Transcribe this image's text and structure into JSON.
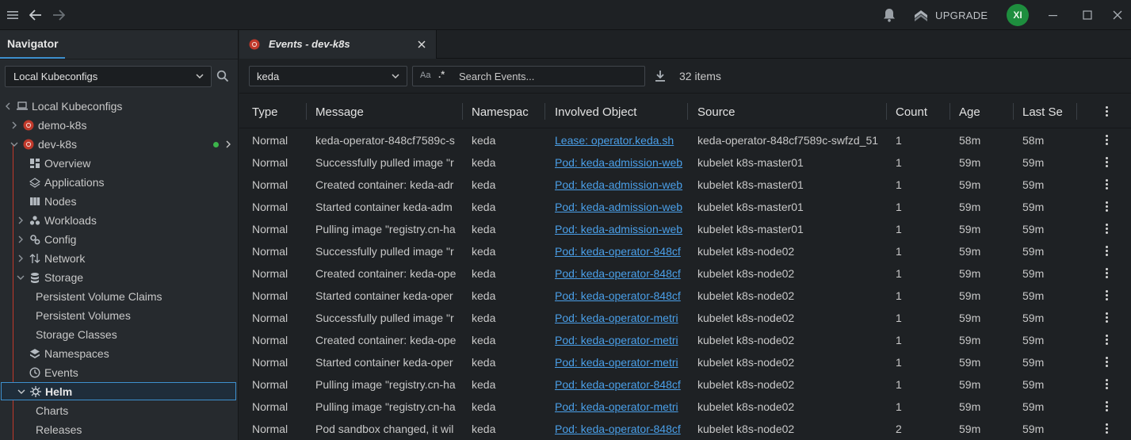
{
  "topbar": {
    "upgrade_label": "UPGRADE",
    "avatar_initials": "XI",
    "avatar_color": "#1e8e3e"
  },
  "navigator": {
    "tab_label": "Navigator",
    "kubeconfig_select": "Local Kubeconfigs",
    "tree": {
      "root": "Local Kubeconfigs",
      "clusters": [
        "demo-k8s",
        "dev-k8s"
      ],
      "items": {
        "overview": "Overview",
        "applications": "Applications",
        "nodes": "Nodes",
        "workloads": "Workloads",
        "config": "Config",
        "network": "Network",
        "storage": "Storage",
        "pvc": "Persistent Volume Claims",
        "pv": "Persistent Volumes",
        "storage_classes": "Storage Classes",
        "namespaces": "Namespaces",
        "events": "Events",
        "helm": "Helm",
        "charts": "Charts",
        "releases": "Releases"
      }
    }
  },
  "main": {
    "tab_title": "Events - dev-k8s",
    "namespace_filter": "keda",
    "search_toggle_case": "Aa",
    "search_toggle_regex": ".*",
    "search_placeholder": "Search Events...",
    "item_count": "32 items",
    "columns": [
      "Type",
      "Message",
      "Namespac",
      "Involved Object",
      "Source",
      "Count",
      "Age",
      "Last Se"
    ],
    "rows": [
      {
        "type": "Normal",
        "message": "keda-operator-848cf7589c-s",
        "namespace": "keda",
        "object": "Lease: operator.keda.sh",
        "source": "keda-operator-848cf7589c-swfzd_51",
        "count": "1",
        "age": "58m",
        "last": "58m"
      },
      {
        "type": "Normal",
        "message": "Successfully pulled image \"r",
        "namespace": "keda",
        "object": "Pod: keda-admission-web",
        "source": "kubelet k8s-master01",
        "count": "1",
        "age": "59m",
        "last": "59m"
      },
      {
        "type": "Normal",
        "message": "Created container: keda-adr",
        "namespace": "keda",
        "object": "Pod: keda-admission-web",
        "source": "kubelet k8s-master01",
        "count": "1",
        "age": "59m",
        "last": "59m"
      },
      {
        "type": "Normal",
        "message": "Started container keda-adm",
        "namespace": "keda",
        "object": "Pod: keda-admission-web",
        "source": "kubelet k8s-master01",
        "count": "1",
        "age": "59m",
        "last": "59m"
      },
      {
        "type": "Normal",
        "message": "Pulling image \"registry.cn-ha",
        "namespace": "keda",
        "object": "Pod: keda-admission-web",
        "source": "kubelet k8s-master01",
        "count": "1",
        "age": "59m",
        "last": "59m"
      },
      {
        "type": "Normal",
        "message": "Successfully pulled image \"r",
        "namespace": "keda",
        "object": "Pod: keda-operator-848cf",
        "source": "kubelet k8s-node02",
        "count": "1",
        "age": "59m",
        "last": "59m"
      },
      {
        "type": "Normal",
        "message": "Created container: keda-ope",
        "namespace": "keda",
        "object": "Pod: keda-operator-848cf",
        "source": "kubelet k8s-node02",
        "count": "1",
        "age": "59m",
        "last": "59m"
      },
      {
        "type": "Normal",
        "message": "Started container keda-oper",
        "namespace": "keda",
        "object": "Pod: keda-operator-848cf",
        "source": "kubelet k8s-node02",
        "count": "1",
        "age": "59m",
        "last": "59m"
      },
      {
        "type": "Normal",
        "message": "Successfully pulled image \"r",
        "namespace": "keda",
        "object": "Pod: keda-operator-metri",
        "source": "kubelet k8s-node02",
        "count": "1",
        "age": "59m",
        "last": "59m"
      },
      {
        "type": "Normal",
        "message": "Created container: keda-ope",
        "namespace": "keda",
        "object": "Pod: keda-operator-metri",
        "source": "kubelet k8s-node02",
        "count": "1",
        "age": "59m",
        "last": "59m"
      },
      {
        "type": "Normal",
        "message": "Started container keda-oper",
        "namespace": "keda",
        "object": "Pod: keda-operator-metri",
        "source": "kubelet k8s-node02",
        "count": "1",
        "age": "59m",
        "last": "59m"
      },
      {
        "type": "Normal",
        "message": "Pulling image \"registry.cn-ha",
        "namespace": "keda",
        "object": "Pod: keda-operator-848cf",
        "source": "kubelet k8s-node02",
        "count": "1",
        "age": "59m",
        "last": "59m"
      },
      {
        "type": "Normal",
        "message": "Pulling image \"registry.cn-ha",
        "namespace": "keda",
        "object": "Pod: keda-operator-metri",
        "source": "kubelet k8s-node02",
        "count": "1",
        "age": "59m",
        "last": "59m"
      },
      {
        "type": "Normal",
        "message": "Pod sandbox changed, it wil",
        "namespace": "keda",
        "object": "Pod: keda-operator-848cf",
        "source": "kubelet k8s-node02",
        "count": "2",
        "age": "59m",
        "last": "59m"
      }
    ]
  },
  "colors": {
    "accent": "#3d90ce",
    "link": "#4a9fe8",
    "cluster_icon": "#c0392b",
    "status_dot": "#3cb44b"
  }
}
